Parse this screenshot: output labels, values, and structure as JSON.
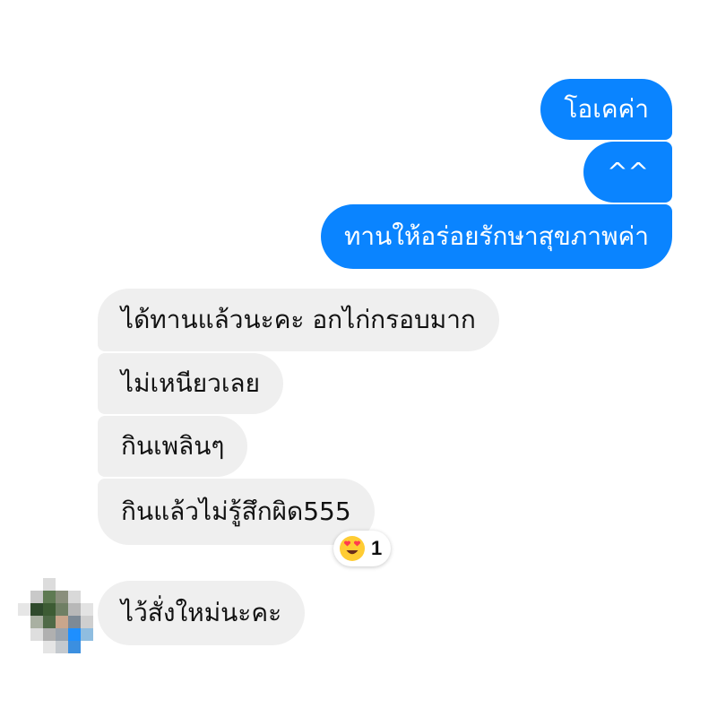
{
  "conversation": {
    "outgoing": [
      {
        "text": "โอเคค่า"
      },
      {
        "text": "^^"
      },
      {
        "text": "ทานให้อร่อยรักษาสุขภาพค่า"
      }
    ],
    "incoming": [
      {
        "text": "ได้ทานแล้วนะคะ อกไก่กรอบมาก"
      },
      {
        "text": "ไม่เหนียวเลย"
      },
      {
        "text": "กินเพลินๆ"
      },
      {
        "text": "กินแล้วไม่รู้สึกผิด555"
      },
      {
        "text": "ไว้สั่งใหม่นะคะ"
      }
    ],
    "reaction": {
      "emoji": "heart-eyes-emoji",
      "count": "1"
    }
  },
  "colors": {
    "outgoing_bubble": "#0a84ff",
    "incoming_bubble": "#efefef",
    "outgoing_text": "#ffffff",
    "incoming_text": "#111111"
  },
  "avatar": {
    "icon": "pixelated-avatar"
  }
}
